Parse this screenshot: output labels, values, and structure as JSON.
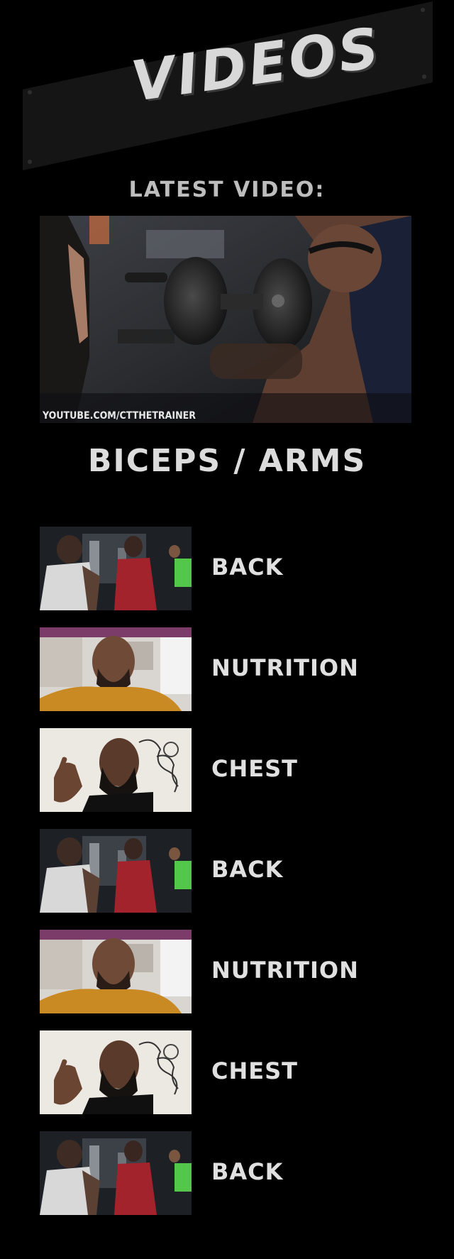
{
  "banner": {
    "title": "VIDEOS"
  },
  "latest": {
    "label": "LATEST VIDEO:",
    "credit": "YOUTUBE.COM/CTTHETRAINER",
    "title": "BICEPS / ARMS"
  },
  "videos": [
    {
      "label": "BACK",
      "thumb": "back"
    },
    {
      "label": "NUTRITION",
      "thumb": "nutrition"
    },
    {
      "label": "CHEST",
      "thumb": "chest"
    },
    {
      "label": "BACK",
      "thumb": "back"
    },
    {
      "label": "NUTRITION",
      "thumb": "nutrition"
    },
    {
      "label": "CHEST",
      "thumb": "chest"
    },
    {
      "label": "BACK",
      "thumb": "back"
    }
  ]
}
